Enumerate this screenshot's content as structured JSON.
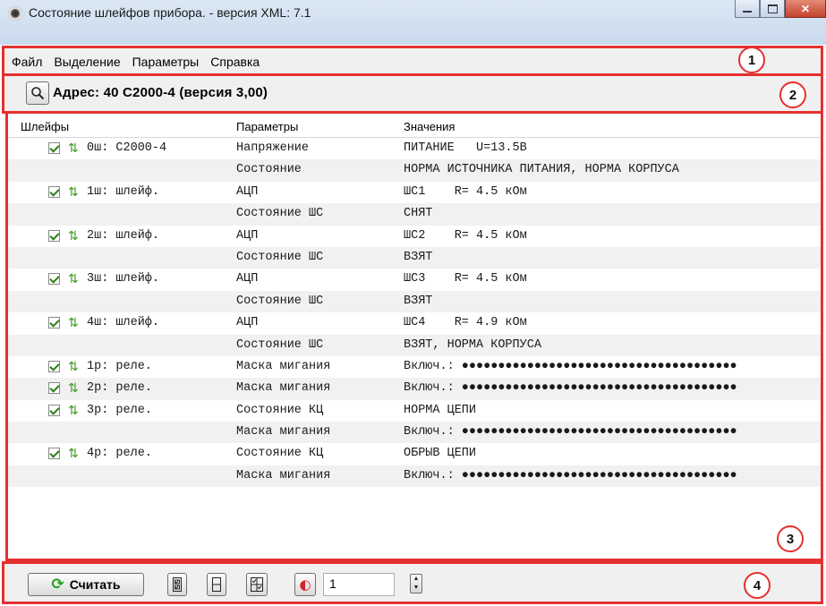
{
  "window": {
    "title": "Состояние шлейфов прибора. - версия XML: 7.1"
  },
  "menu": [
    "Файл",
    "Выделение",
    "Параметры",
    "Справка"
  ],
  "address": {
    "text": "Адрес:  40  С2000-4 (версия  3,00)"
  },
  "table": {
    "headers": [
      "Шлейфы",
      "Параметры",
      "Значения"
    ],
    "rows": [
      {
        "checked": true,
        "name": "0ш: С2000-4",
        "param": "Напряжение",
        "value": "ПИТАНИЕ   U=13.5В"
      },
      {
        "checked": false,
        "name": "",
        "param": "Состояние",
        "value": "НОРМА ИСТОЧНИКА ПИТАНИЯ, НОРМА КОРПУСА"
      },
      {
        "checked": true,
        "name": "1ш: шлейф.",
        "param": "АЦП",
        "value": "ШС1    R= 4.5 кОм"
      },
      {
        "checked": false,
        "name": "",
        "param": "Состояние ШС",
        "value": "СНЯТ"
      },
      {
        "checked": true,
        "name": "2ш: шлейф.",
        "param": "АЦП",
        "value": "ШС2    R= 4.5 кОм"
      },
      {
        "checked": false,
        "name": "",
        "param": "Состояние ШС",
        "value": "ВЗЯТ"
      },
      {
        "checked": true,
        "name": "3ш: шлейф.",
        "param": "АЦП",
        "value": "ШС3    R= 4.5 кОм"
      },
      {
        "checked": false,
        "name": "",
        "param": "Состояние ШС",
        "value": "ВЗЯТ"
      },
      {
        "checked": true,
        "name": "4ш: шлейф.",
        "param": "АЦП",
        "value": "ШС4    R= 4.9 кОм"
      },
      {
        "checked": false,
        "name": "",
        "param": "Состояние ШС",
        "value": "ВЗЯТ, НОРМА КОРПУСА"
      },
      {
        "checked": true,
        "name": "1р: реле.",
        "param": "Маска мигания",
        "value": "Включ.: ●●●●●●●●●●●●●●●●●●●●●●●●●●●●●●●●●●●●●●"
      },
      {
        "checked": true,
        "name": "2р: реле.",
        "param": "Маска мигания",
        "value": "Включ.: ●●●●●●●●●●●●●●●●●●●●●●●●●●●●●●●●●●●●●●"
      },
      {
        "checked": true,
        "name": "3р: реле.",
        "param": "Состояние КЦ",
        "value": "НОРМА ЦЕПИ"
      },
      {
        "checked": false,
        "name": "",
        "param": "Маска мигания",
        "value": "Включ.: ●●●●●●●●●●●●●●●●●●●●●●●●●●●●●●●●●●●●●●"
      },
      {
        "checked": true,
        "name": "4р: реле.",
        "param": "Состояние КЦ",
        "value": "ОБРЫВ ЦЕПИ"
      },
      {
        "checked": false,
        "name": "",
        "param": "Маска мигания",
        "value": "Включ.: ●●●●●●●●●●●●●●●●●●●●●●●●●●●●●●●●●●●●●●"
      }
    ]
  },
  "toolbar": {
    "read_label": "Считать",
    "count_value": "1"
  },
  "badges": [
    "1",
    "2",
    "3",
    "4"
  ],
  "colors": {
    "highlight": "#e53030",
    "refresh_icon": "#3c9c1c",
    "stop_icon": "#d52222"
  }
}
